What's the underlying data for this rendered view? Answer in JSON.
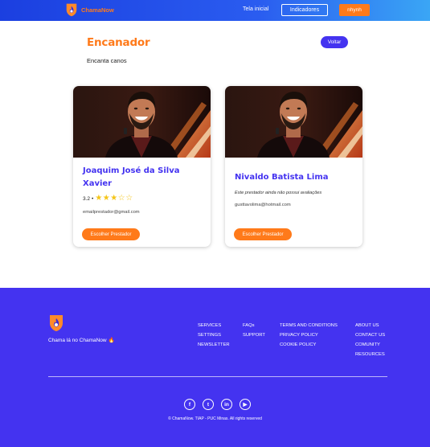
{
  "navbar": {
    "brand": "ChamaNow",
    "home_link": "Tela inicial",
    "indicators_button": "Indicadores",
    "user_button": "nhynh",
    "logo_icon": "flame-shield-icon"
  },
  "header": {
    "title": "Encanador",
    "subtitle": "Encanta canos",
    "back_button": "Voltar"
  },
  "providers": [
    {
      "name": "Joaquim José da Silva Xavier",
      "rating_value": "3.2",
      "rating_separator": "•",
      "stars": {
        "filled": 3,
        "total": 5
      },
      "email": "emailprestador@gmail.com",
      "choose_button": "Escolher Prestador",
      "photo": "singer-smiling-photo"
    },
    {
      "name": "Nivaldo Batista Lima",
      "no_rating_text": "Este prestador ainda não possui avaliações",
      "email": "gusttavolima@hotmail.com",
      "choose_button": "Escolher Prestador",
      "photo": "singer-smiling-photo"
    }
  ],
  "footer": {
    "tagline": "Chama lá no ChamaNow",
    "columns": [
      [
        "SERVICES",
        "SETTINGS",
        "NEWSLETTER"
      ],
      [
        "FAQs",
        "SUPPORT"
      ],
      [
        "TERMS AND CONDITIONS",
        "PRIVACY POLICY",
        "COOKIE POLICY"
      ],
      [
        "ABOUT US",
        "CONTACT US",
        "COMUNITY",
        "RESOURCES"
      ]
    ],
    "socials": [
      "facebook-icon",
      "twitter-icon",
      "linkedin-icon",
      "youtube-icon"
    ],
    "social_letters": [
      "f",
      "t",
      "in",
      "▶"
    ],
    "copyright": "© ChamaNow. TIAP - PUC Minas. All rights reserved"
  },
  "colors": {
    "accent_orange": "#ff7a1a",
    "brand_purple": "#4433f0",
    "nav_blue": "#1b3fe0",
    "star_yellow": "#f5c518"
  }
}
